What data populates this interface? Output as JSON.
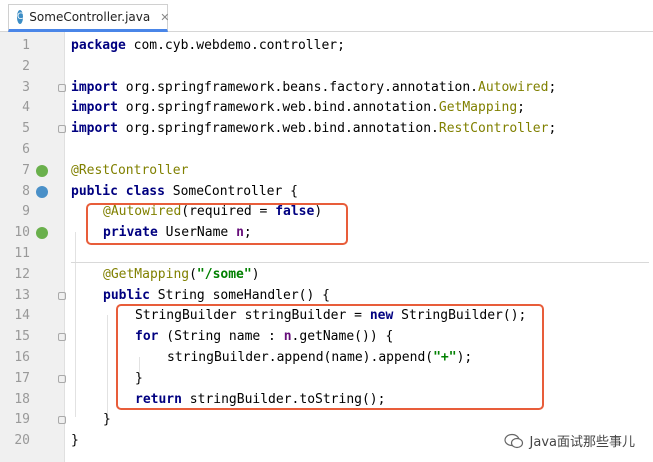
{
  "tab": {
    "title": "SomeController.java",
    "icon_letter": "C",
    "close": "✕"
  },
  "lines": [
    {
      "n": "1"
    },
    {
      "n": "2"
    },
    {
      "n": "3"
    },
    {
      "n": "4"
    },
    {
      "n": "5"
    },
    {
      "n": "6"
    },
    {
      "n": "7"
    },
    {
      "n": "8"
    },
    {
      "n": "9"
    },
    {
      "n": "10"
    },
    {
      "n": "11"
    },
    {
      "n": "12"
    },
    {
      "n": "13"
    },
    {
      "n": "14"
    },
    {
      "n": "15"
    },
    {
      "n": "16"
    },
    {
      "n": "17"
    },
    {
      "n": "18"
    },
    {
      "n": "19"
    },
    {
      "n": "20"
    }
  ],
  "code": {
    "l1_kw": "package",
    "l1_rest": " com.cyb.webdemo.controller;",
    "l3_kw": "import",
    "l3_rest": " org.springframework.beans.factory.annotation.",
    "l3_cls": "Autowired",
    "l3_end": ";",
    "l4_kw": "import",
    "l4_rest": " org.springframework.web.bind.annotation.",
    "l4_cls": "GetMapping",
    "l4_end": ";",
    "l5_kw": "import",
    "l5_rest": " org.springframework.web.bind.annotation.",
    "l5_cls": "RestController",
    "l5_end": ";",
    "l7_ann": "@RestController",
    "l8_kw": "public class",
    "l8_rest": " SomeController {",
    "l9_ann": "@Autowired",
    "l9_rest": "(required = ",
    "l9_kw": "false",
    "l9_end": ")",
    "l10_kw": "private",
    "l10_rest": " UserName ",
    "l10_fld": "n",
    "l10_end": ";",
    "l12_ann": "@GetMapping",
    "l12_open": "(",
    "l12_str": "\"/some\"",
    "l12_close": ")",
    "l13_kw": "public",
    "l13_rest": " String someHandler() {",
    "l14_a": "StringBuilder stringBuilder = ",
    "l14_kw": "new",
    "l14_b": " StringBuilder();",
    "l15_kw": "for",
    "l15_a": " (String name : ",
    "l15_fld": "n",
    "l15_b": ".getName()) {",
    "l16_a": "stringBuilder.append(name).append(",
    "l16_str": "\"+\"",
    "l16_b": ");",
    "l17": "}",
    "l18_kw": "return",
    "l18_rest": " stringBuilder.toString();",
    "l19": "}",
    "l20": "}"
  },
  "watermark": {
    "text": "Java面试那些事儿"
  },
  "colors": {
    "highlight_box": "#e85d3a",
    "keyword": "#000080",
    "annotation": "#808000",
    "string": "#008000",
    "field": "#660e7a",
    "tab_accent": "#4a86e8"
  }
}
